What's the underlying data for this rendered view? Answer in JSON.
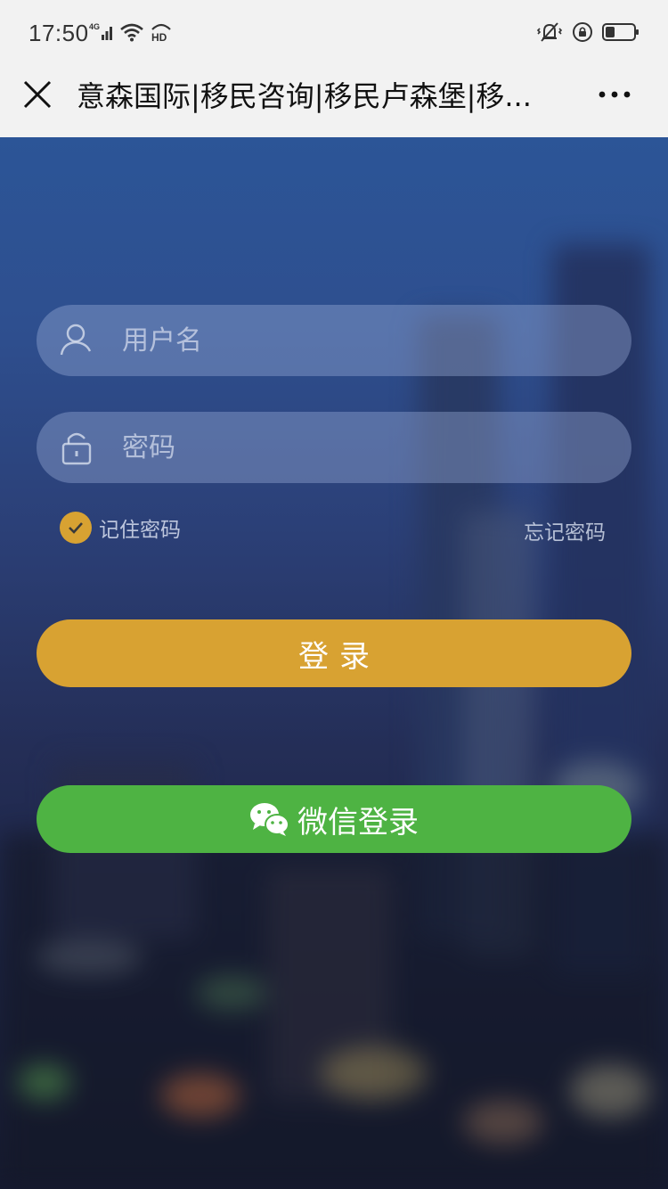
{
  "status_bar": {
    "time": "17:50",
    "network": "4G",
    "hd": "HD"
  },
  "title_bar": {
    "title": "意森国际|移民咨询|移民卢森堡|移..."
  },
  "form": {
    "username_placeholder": "用户名",
    "password_placeholder": "密码",
    "remember_label": "记住密码",
    "remember_checked": true,
    "forgot_label": "忘记密码",
    "login_label": "登录",
    "wechat_login_label": "微信登录"
  },
  "colors": {
    "accent_gold": "#d8a232",
    "wechat_green": "#4eb343",
    "status_bar_bg": "#f2f2f2"
  },
  "icons": {
    "close": "close-icon",
    "more": "more-icon",
    "username": "user-icon",
    "password": "lock-icon",
    "checkbox": "checkmark-icon",
    "wechat": "wechat-icon"
  }
}
